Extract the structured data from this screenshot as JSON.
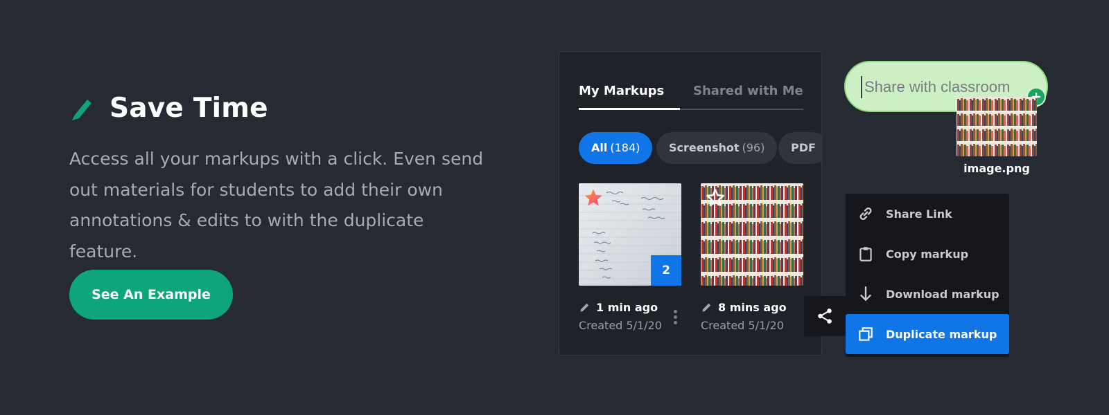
{
  "hero": {
    "title": "Save Time",
    "description": "Access all your markups with a click. Even send out materials for students to add their own annotations & edits to with the duplicate feature.",
    "cta_label": "See An Example",
    "accent_color": "#0fa57a"
  },
  "panel": {
    "tabs": [
      {
        "label": "My Markups",
        "active": true
      },
      {
        "label": "Shared with Me",
        "active": false
      }
    ],
    "filters": [
      {
        "label": "All",
        "count": "(184)",
        "active": true
      },
      {
        "label": "Screenshot",
        "count": "(96)",
        "active": false
      },
      {
        "label": "PDF",
        "count": "",
        "active": false
      }
    ],
    "cards": [
      {
        "edited": "1 min ago",
        "created": "Created 5/1/20",
        "starred": true,
        "badge": "2",
        "thumbnail": "handwritten-notes"
      },
      {
        "edited": "8 mins ago",
        "created": "Created 5/1/20",
        "starred": false,
        "badge": "",
        "thumbnail": "bookshelf"
      }
    ]
  },
  "menu": {
    "items": [
      {
        "label": "Share Link",
        "icon": "link-icon",
        "selected": false
      },
      {
        "label": "Copy markup",
        "icon": "clipboard-icon",
        "selected": false
      },
      {
        "label": "Download markup",
        "icon": "download-icon",
        "selected": false
      },
      {
        "label": "Duplicate markup",
        "icon": "duplicate-icon",
        "selected": true
      }
    ],
    "selected_color": "#1075e6"
  },
  "classroom": {
    "placeholder": "Share with classroom",
    "value": "",
    "file_name": "image.png"
  },
  "icons": {
    "title": "pencil-icon",
    "share": "share-icon",
    "add": "plus-icon"
  }
}
